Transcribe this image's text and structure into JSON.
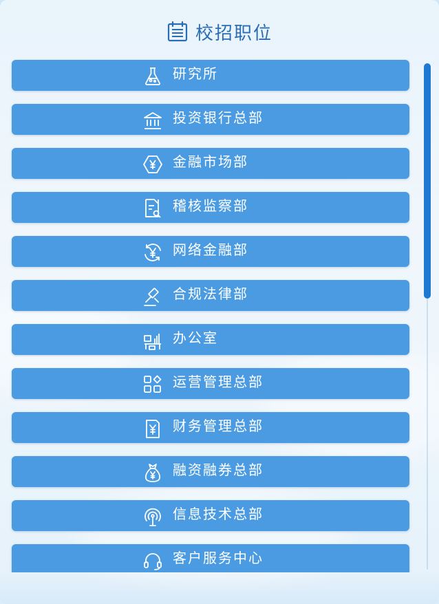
{
  "header": {
    "title": "校招职位",
    "icon": "calendar-list-icon"
  },
  "positions": [
    {
      "label": "研究所",
      "icon": "flask-icon"
    },
    {
      "label": "投资银行总部",
      "icon": "bank-icon"
    },
    {
      "label": "金融市场部",
      "icon": "yen-hexagon-icon"
    },
    {
      "label": "稽核监察部",
      "icon": "document-search-icon"
    },
    {
      "label": "网络金融部",
      "icon": "yen-cycle-icon"
    },
    {
      "label": "合规法律部",
      "icon": "gavel-icon"
    },
    {
      "label": "办公室",
      "icon": "office-desk-icon"
    },
    {
      "label": "运营管理总部",
      "icon": "apps-grid-icon"
    },
    {
      "label": "财务管理总部",
      "icon": "yen-document-icon"
    },
    {
      "label": "融资融券总部",
      "icon": "money-bag-icon"
    },
    {
      "label": "信息技术总部",
      "icon": "signal-tower-icon"
    },
    {
      "label": "客户服务中心",
      "icon": "headset-icon"
    }
  ],
  "colors": {
    "item_background": "#4a9be2",
    "title_color": "#2a6db5",
    "scrollbar_thumb": "#1f78d1"
  },
  "scroll": {
    "position_fraction": 0.0,
    "visible_fraction": 0.46
  }
}
